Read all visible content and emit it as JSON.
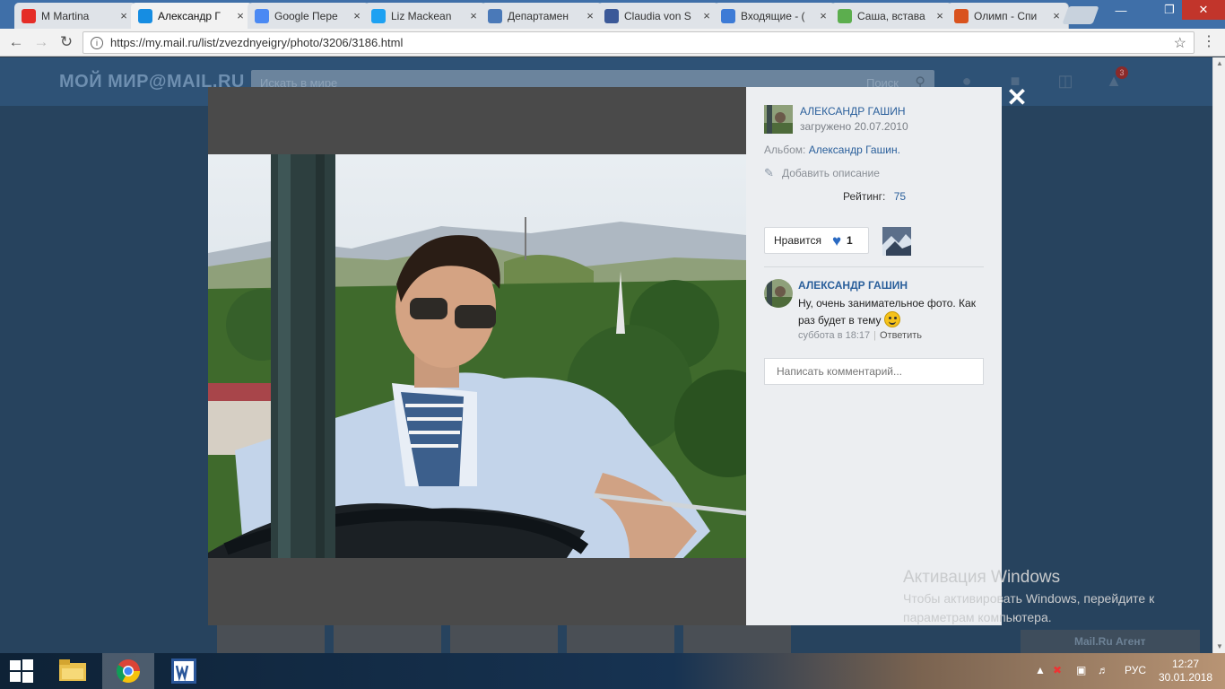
{
  "browser": {
    "tabs": [
      {
        "label": "M Martina",
        "favicon": "youtube-icon",
        "color": "#e52d27"
      },
      {
        "label": "Александр Г",
        "favicon": "mail-ru-icon",
        "color": "#168de2",
        "active": true
      },
      {
        "label": "Google Пере",
        "favicon": "google-translate-icon",
        "color": "#4a89f3"
      },
      {
        "label": "Liz Mackean",
        "favicon": "twitter-icon",
        "color": "#1da1f2"
      },
      {
        "label": "Департамен",
        "favicon": "ukraine-trident-icon",
        "color": "#4a79b8"
      },
      {
        "label": "Claudia von S",
        "favicon": "facebook-icon",
        "color": "#3b5998"
      },
      {
        "label": "Входящие - (",
        "favicon": "mail-icon",
        "color": "#3d7bd6"
      },
      {
        "label": "Саша, встава",
        "favicon": "document-icon",
        "color": "#5cae4e"
      },
      {
        "label": "Олимп - Спи",
        "favicon": "olymp-icon",
        "color": "#d9531e"
      }
    ],
    "url": "https://my.mail.ru/list/zvezdnyeigry/photo/3206/3186.html"
  },
  "site": {
    "logo": "МОЙ МИР@MAIL.RU",
    "search_placeholder": "Искать в мире",
    "search_button": "Поиск",
    "notification_count": "3",
    "agent_label": "Mail.Ru Агент"
  },
  "photo_panel": {
    "author": "АЛЕКСАНДР ГАШИН",
    "uploaded": "загружено 20.07.2010",
    "album_label": "Альбом:",
    "album_name": "Александр Гашин.",
    "add_description": "Добавить описание",
    "rating_label": "Рейтинг:",
    "rating_value": "75",
    "like_label": "Нравится",
    "like_count": "1",
    "comment": {
      "author": "АЛЕКСАНДР ГАШИН",
      "text": "Ну, очень занимательное фото. Как раз будет в тему",
      "time": "суббота в 18:17",
      "reply": "Ответить"
    },
    "comment_placeholder": "Написать комментарий..."
  },
  "watermark": {
    "title": "Активация Windows",
    "text": "Чтобы активировать Windows, перейдите к параметрам компьютера."
  },
  "taskbar": {
    "lang": "РУС",
    "time": "12:27",
    "date": "30.01.2018"
  }
}
